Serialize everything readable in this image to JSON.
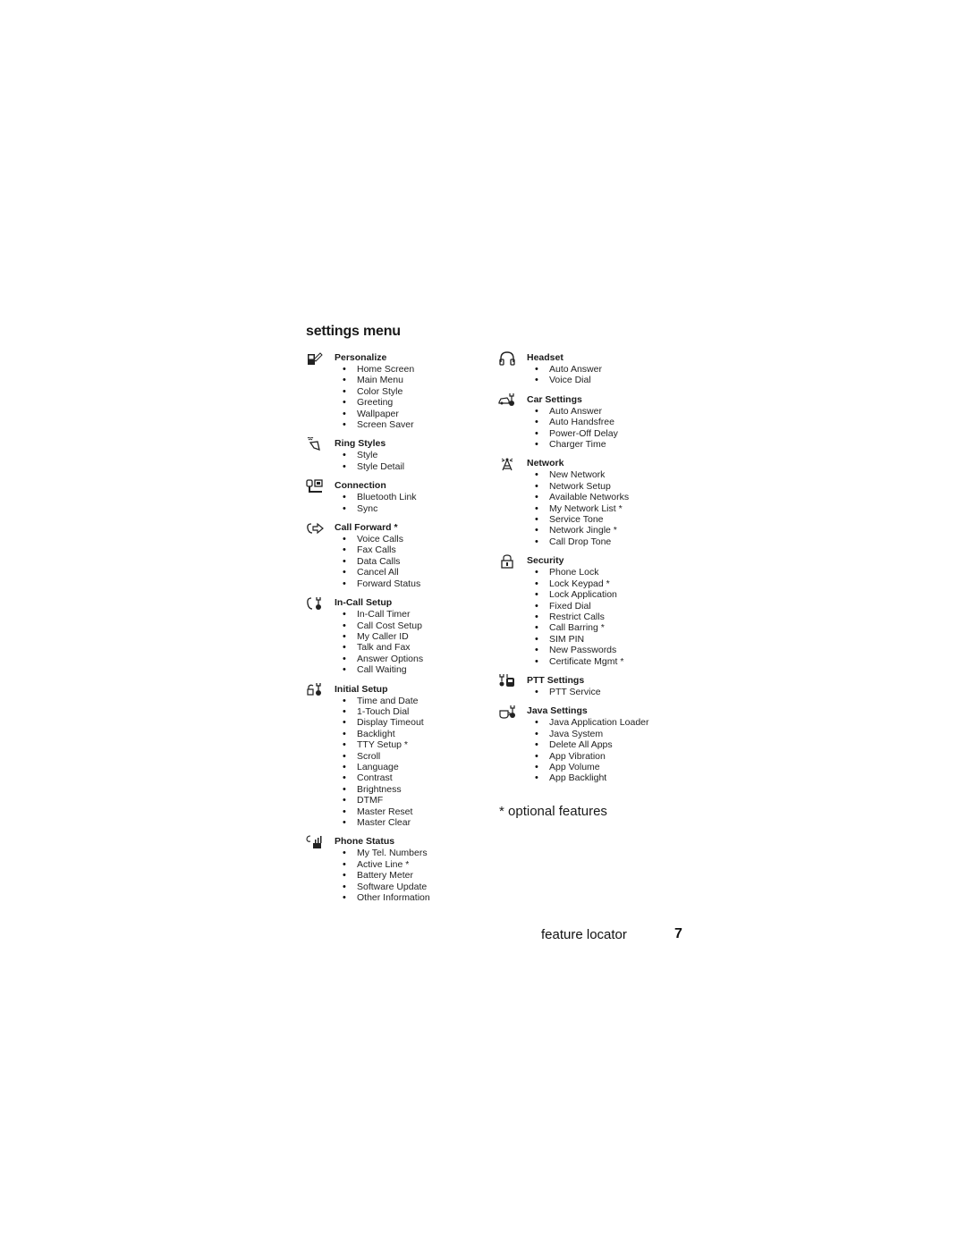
{
  "page": {
    "title": "settings menu",
    "note": "* optional features",
    "footer_label": "feature locator",
    "page_number": "7"
  },
  "left_sections": [
    {
      "icon": "personalize-icon",
      "title": "Personalize",
      "items": [
        "Home Screen",
        "Main Menu",
        "Color Style",
        "Greeting",
        "Wallpaper",
        "Screen Saver"
      ]
    },
    {
      "icon": "ring-styles-icon",
      "title": "Ring Styles",
      "items": [
        "Style",
        "Style Detail"
      ]
    },
    {
      "icon": "connection-icon",
      "title": "Connection",
      "items": [
        "Bluetooth Link",
        "Sync"
      ]
    },
    {
      "icon": "call-forward-icon",
      "title": "Call Forward *",
      "items": [
        "Voice Calls",
        "Fax Calls",
        "Data Calls",
        "Cancel All",
        "Forward Status"
      ]
    },
    {
      "icon": "in-call-setup-icon",
      "title": "In-Call Setup",
      "items": [
        "In-Call Timer",
        "Call Cost Setup",
        "My Caller ID",
        "Talk and Fax",
        "Answer Options",
        "Call Waiting"
      ]
    },
    {
      "icon": "initial-setup-icon",
      "title": "Initial Setup",
      "items": [
        "Time and Date",
        "1-Touch Dial",
        "Display Timeout",
        "Backlight",
        "TTY Setup *",
        "Scroll",
        "Language",
        "Contrast",
        "Brightness",
        "DTMF",
        "Master Reset",
        "Master Clear"
      ]
    },
    {
      "icon": "phone-status-icon",
      "title": "Phone Status",
      "items": [
        "My Tel. Numbers",
        "Active Line *",
        "Battery Meter",
        "Software Update",
        "Other Information"
      ]
    }
  ],
  "right_sections": [
    {
      "icon": "headset-icon",
      "title": "Headset",
      "items": [
        "Auto Answer",
        "Voice Dial"
      ]
    },
    {
      "icon": "car-settings-icon",
      "title": "Car Settings",
      "items": [
        "Auto Answer",
        "Auto Handsfree",
        "Power-Off Delay",
        "Charger Time"
      ]
    },
    {
      "icon": "network-icon",
      "title": "Network",
      "items": [
        "New Network",
        "Network Setup",
        "Available Networks",
        "My Network List *",
        "Service Tone",
        "Network Jingle *",
        "Call Drop Tone"
      ]
    },
    {
      "icon": "security-icon",
      "title": "Security",
      "items": [
        "Phone Lock",
        "Lock Keypad *",
        "Lock Application",
        "Fixed Dial",
        "Restrict Calls",
        "Call Barring *",
        "SIM PIN",
        "New Passwords",
        "Certificate Mgmt *"
      ]
    },
    {
      "icon": "ptt-settings-icon",
      "title": "PTT Settings",
      "items": [
        "PTT Service"
      ]
    },
    {
      "icon": "java-settings-icon",
      "title": "Java Settings",
      "items": [
        "Java Application Loader",
        "Java System",
        "Delete All Apps",
        "App Vibration",
        "App Volume",
        "App Backlight"
      ]
    }
  ]
}
